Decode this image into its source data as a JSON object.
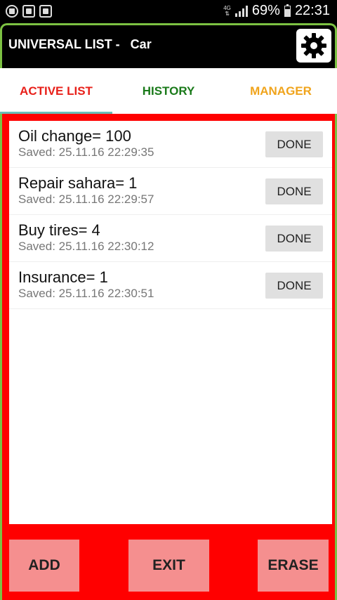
{
  "status_bar": {
    "network": "4G",
    "battery": "69%",
    "battery_level": 0.69,
    "time": "22:31"
  },
  "header": {
    "title": "UNIVERSAL LIST -   Car",
    "settings_icon": "gear-icon",
    "accent_color": "#7cc142"
  },
  "tabs": [
    {
      "label": "ACTIVE LIST",
      "color": "#e8201a",
      "active": true
    },
    {
      "label": "HISTORY",
      "color": "#1a7a1a",
      "active": false
    },
    {
      "label": "MANAGER",
      "color": "#f0a41c",
      "active": false
    }
  ],
  "items": [
    {
      "title": "Oil change= 100",
      "saved": "Saved: 25.11.16 22:29:35",
      "button": "DONE"
    },
    {
      "title": "Repair sahara= 1",
      "saved": "Saved: 25.11.16 22:29:57",
      "button": "DONE"
    },
    {
      "title": "Buy tires= 4",
      "saved": "Saved: 25.11.16 22:30:12",
      "button": "DONE"
    },
    {
      "title": "Insurance= 1",
      "saved": "Saved: 25.11.16 22:30:51",
      "button": "DONE"
    }
  ],
  "bottom_buttons": {
    "add": "ADD",
    "exit": "EXIT",
    "erase": "ERASE"
  },
  "colors": {
    "panel": "#ff0000",
    "button": "#f58f8f"
  }
}
